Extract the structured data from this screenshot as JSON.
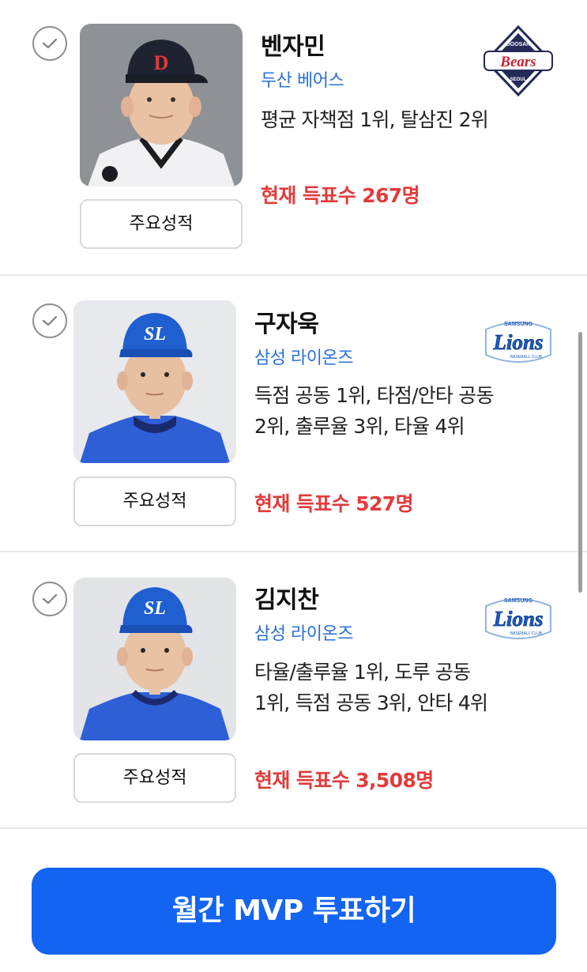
{
  "players": [
    {
      "name": "벤자민",
      "team": "두산 베어스",
      "record": "평균 자책점 1위, 탈삼진 2위",
      "votes": "현재 득표수 267명",
      "stats_button": "주요성적",
      "team_logo": "bears-logo",
      "cap_letter": "D",
      "cap_color": "#1f2230",
      "jersey_color": "#f1f1f3",
      "selected": false
    },
    {
      "name": "구자욱",
      "team": "삼성 라이온즈",
      "record": "득점 공동 1위, 타점/안타 공동 2위, 출루율 3위, 타율 4위",
      "votes": "현재 득표수 527명",
      "stats_button": "주요성적",
      "team_logo": "lions-logo",
      "cap_letter": "SL",
      "cap_color": "#1f5fd0",
      "jersey_color": "#2f5fd6",
      "selected": false
    },
    {
      "name": "김지찬",
      "team": "삼성 라이온즈",
      "record": "타율/출루율 1위, 도루 공동 1위, 득점 공동 3위, 안타 4위",
      "votes": "현재 득표수 3,508명",
      "stats_button": "주요성적",
      "team_logo": "lions-logo",
      "cap_letter": "SL",
      "cap_color": "#1f5fd0",
      "jersey_color": "#2f5fd6",
      "selected": false
    }
  ],
  "logos": {
    "bears": {
      "top": "DOOSAN",
      "main": "Bears",
      "bottom": "SEOUL"
    },
    "lions": {
      "top": "SAMSUNG",
      "main": "Lions",
      "bottom": "BASEBALL CLUB"
    }
  },
  "vote_button": "월간 MVP 투표하기",
  "colors": {
    "accent": "#1464f4",
    "team_text": "#2b6fd8",
    "votes_text": "#e23b3b",
    "divider": "#e9eaee"
  }
}
